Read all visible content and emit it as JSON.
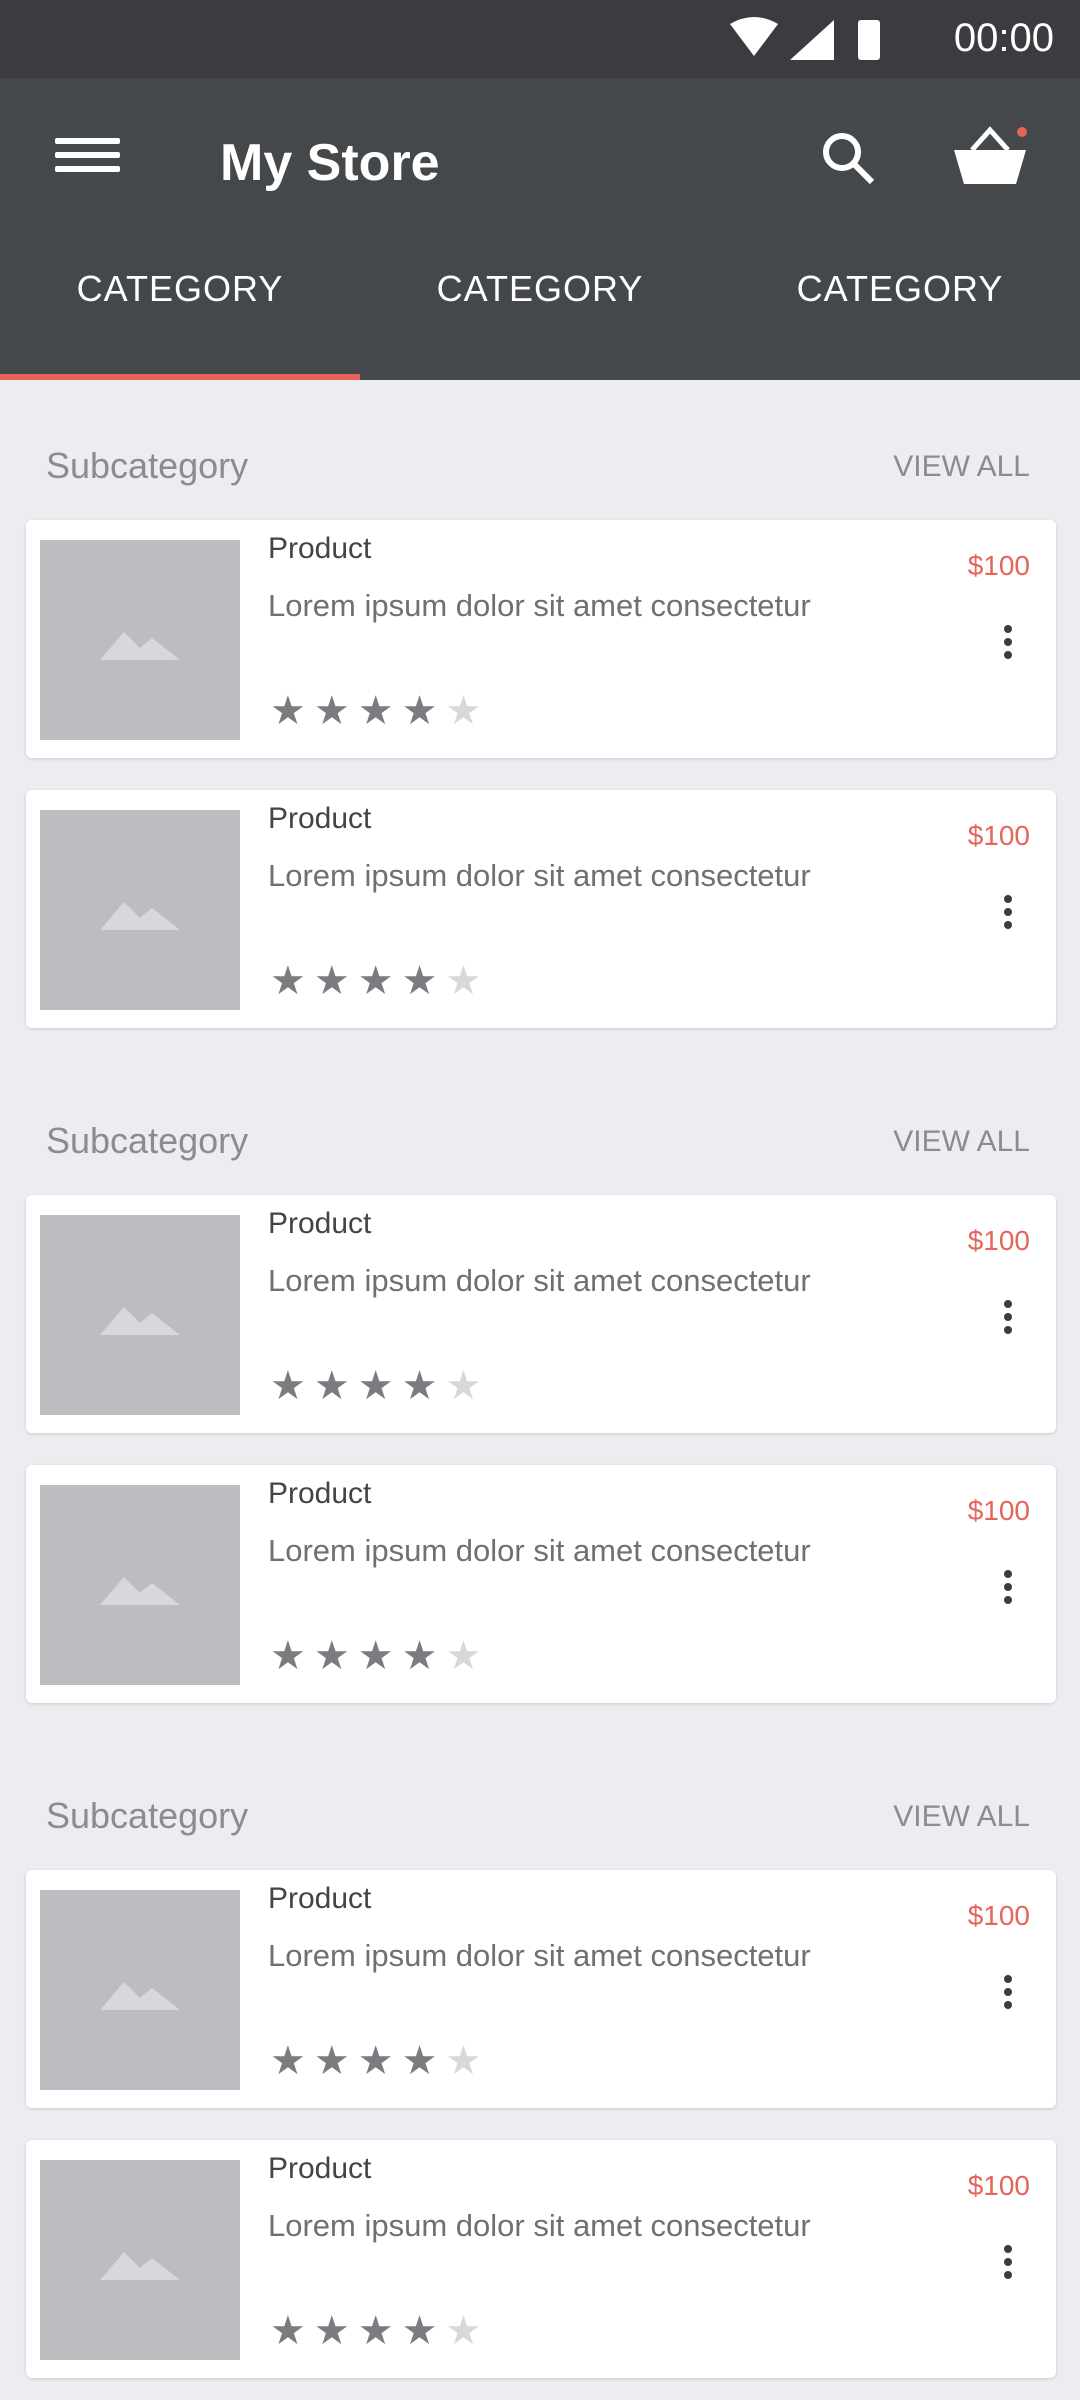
{
  "status": {
    "time": "00:00"
  },
  "appbar": {
    "title": "My Store",
    "tabs": [
      "CATEGORY",
      "CATEGORY",
      "CATEGORY"
    ]
  },
  "sections": [
    {
      "subcategory": "Subcategory",
      "view_all": "VIEW ALL",
      "products": [
        {
          "name": "Product",
          "description": "Lorem ipsum dolor sit amet consectetur",
          "price": "$100",
          "rating": 4
        },
        {
          "name": "Product",
          "description": "Lorem ipsum dolor sit amet consectetur",
          "price": "$100",
          "rating": 4
        }
      ]
    },
    {
      "subcategory": "Subcategory",
      "view_all": "VIEW ALL",
      "products": [
        {
          "name": "Product",
          "description": "Lorem ipsum dolor sit amet consectetur",
          "price": "$100",
          "rating": 4
        },
        {
          "name": "Product",
          "description": "Lorem ipsum dolor sit amet consectetur",
          "price": "$100",
          "rating": 4
        }
      ]
    },
    {
      "subcategory": "Subcategory",
      "view_all": "VIEW ALL",
      "products": [
        {
          "name": "Product",
          "description": "Lorem ipsum dolor sit amet consectetur",
          "price": "$100",
          "rating": 4
        },
        {
          "name": "Product",
          "description": "Lorem ipsum dolor sit amet consectetur",
          "price": "$100",
          "rating": 4
        }
      ]
    }
  ],
  "icons": {
    "menu": "menu-icon",
    "search": "search-icon",
    "cart": "cart-icon",
    "more": "more-vert-icon",
    "image": "image-placeholder-icon",
    "star": "star-icon"
  },
  "colors": {
    "appbar": "#45484B",
    "accent": "#E6645A",
    "background": "#ECEDF1"
  }
}
